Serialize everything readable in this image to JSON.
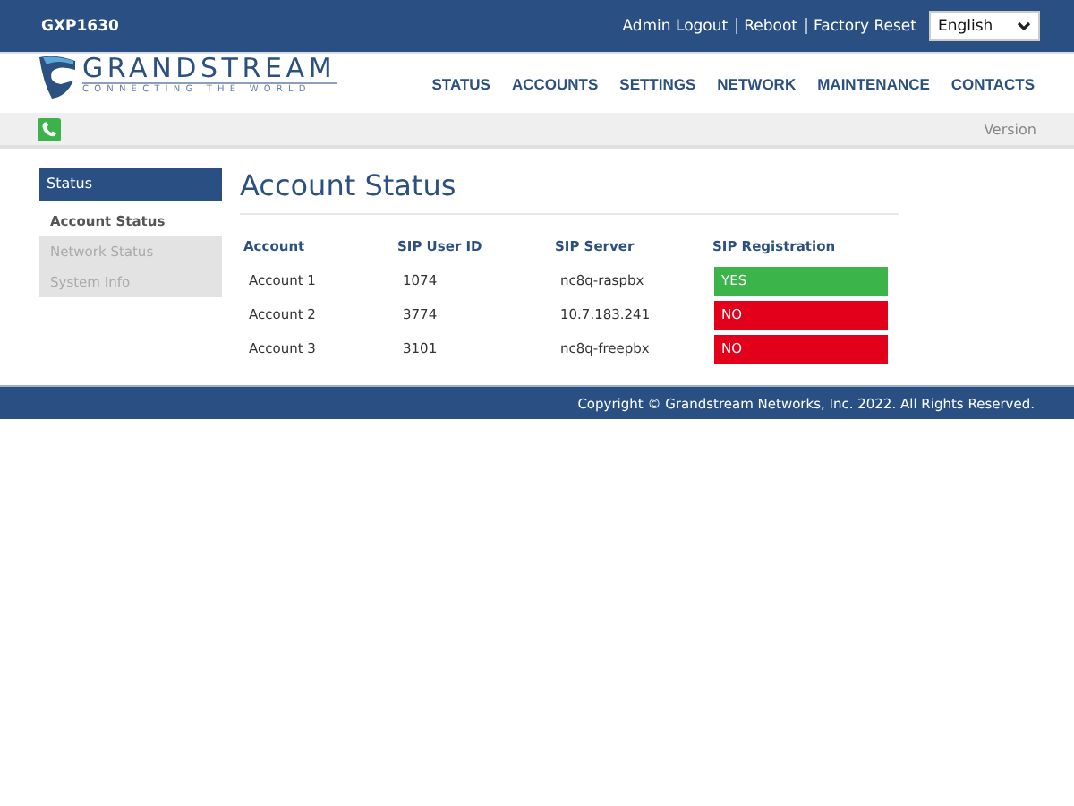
{
  "top_bar": {
    "model": "GXP1630",
    "links": [
      "Admin Logout",
      "Reboot",
      "Factory Reset"
    ],
    "language": "English"
  },
  "logo": {
    "name": "GRANDSTREAM",
    "tagline": "CONNECTING THE WORLD"
  },
  "nav": [
    "STATUS",
    "ACCOUNTS",
    "SETTINGS",
    "NETWORK",
    "MAINTENANCE",
    "CONTACTS"
  ],
  "sub_bar": {
    "version_label": "Version"
  },
  "sidebar": {
    "title": "Status",
    "items": [
      {
        "label": "Account Status",
        "selected": true
      },
      {
        "label": "Network Status",
        "selected": false
      },
      {
        "label": "System Info",
        "selected": false
      }
    ]
  },
  "page_title": "Account Status",
  "table": {
    "columns": [
      "Account",
      "SIP User ID",
      "SIP Server",
      "SIP Registration"
    ],
    "rows": [
      {
        "account": "Account 1",
        "user_id": "1074",
        "server": "nc8q-raspbx",
        "registration": "YES",
        "registered": true
      },
      {
        "account": "Account 2",
        "user_id": "3774",
        "server": "10.7.183.241",
        "registration": "NO",
        "registered": false
      },
      {
        "account": "Account 3",
        "user_id": "3101",
        "server": "nc8q-freepbx",
        "registration": "NO",
        "registered": false
      }
    ]
  },
  "footer": "Copyright © Grandstream Networks, Inc. 2022. All Rights Reserved."
}
